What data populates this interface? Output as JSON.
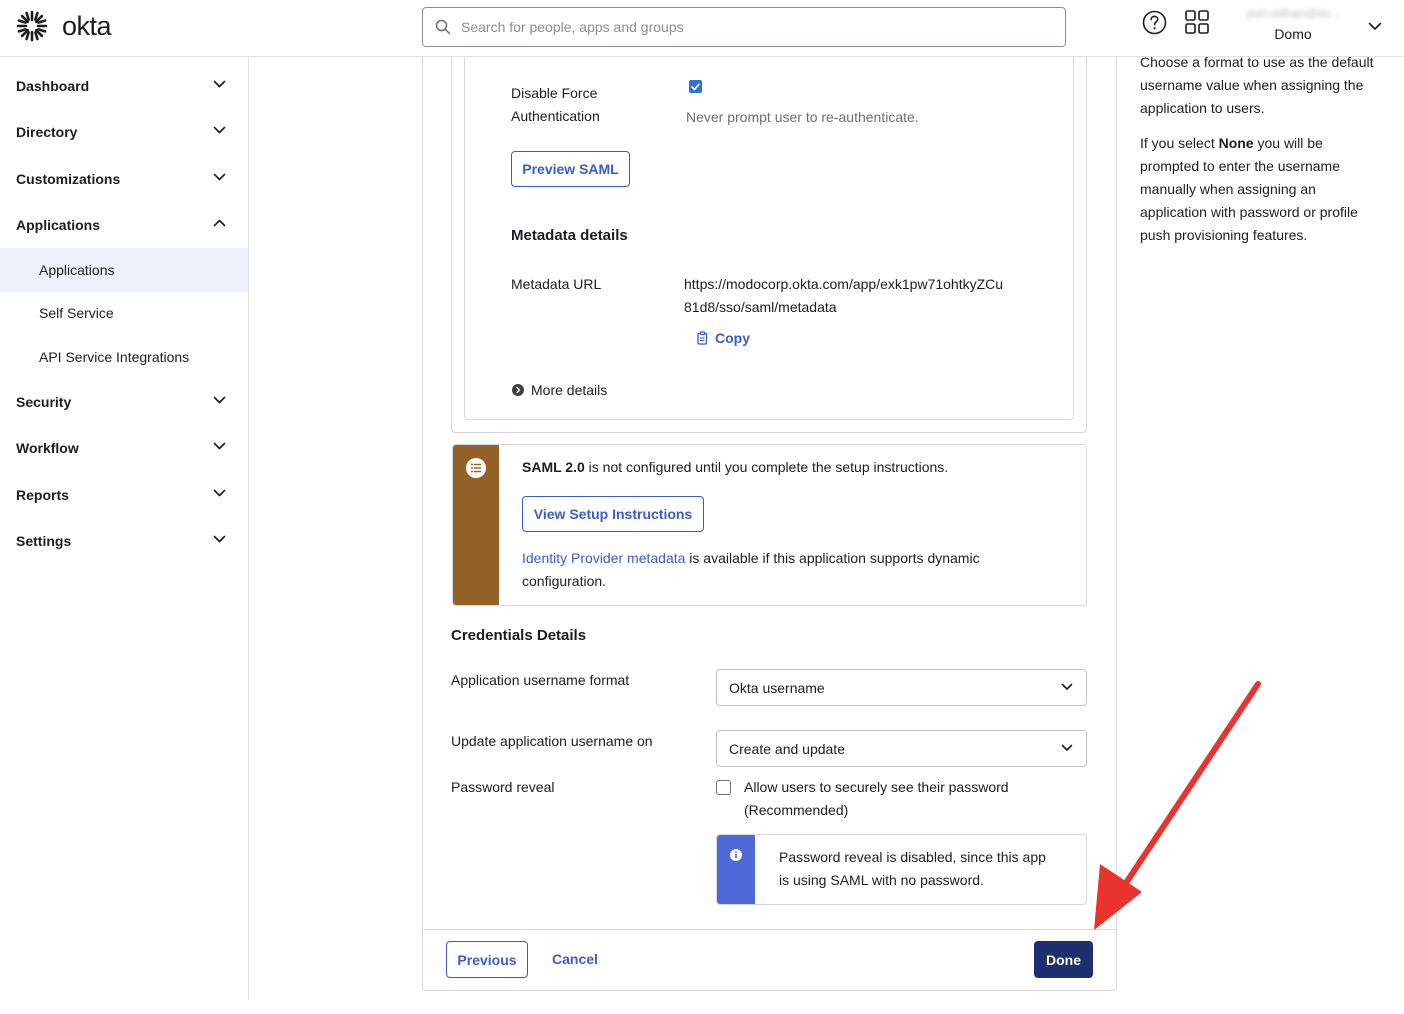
{
  "header": {
    "logo_text": "okta",
    "search_placeholder": "Search for people, apps and groups",
    "user_email": "josh.oldham@do...",
    "org_name": "Domo"
  },
  "sidebar": {
    "items": [
      {
        "label": "Dashboard"
      },
      {
        "label": "Directory"
      },
      {
        "label": "Customizations"
      },
      {
        "label": "Applications"
      },
      {
        "label": "Security"
      },
      {
        "label": "Workflow"
      },
      {
        "label": "Reports"
      },
      {
        "label": "Settings"
      }
    ],
    "applications_sub": [
      {
        "label": "Applications"
      },
      {
        "label": "Self Service"
      },
      {
        "label": "API Service Integrations"
      }
    ]
  },
  "sign_on": {
    "disable_force_label_line1": "Disable Force",
    "disable_force_label_line2": "Authentication",
    "disable_force_checked": true,
    "disable_force_help": "Never prompt user to re-authenticate.",
    "preview_saml_label": "Preview SAML",
    "metadata_title": "Metadata details",
    "metadata_url_label": "Metadata URL",
    "metadata_url_line1": "https://modocorp.okta.com/app/exk1pw71ohtkyZCu",
    "metadata_url_line2": "81d8/sso/saml/metadata",
    "copy_label": "Copy",
    "more_details_label": "More details"
  },
  "saml_callout": {
    "bold": "SAML 2.0",
    "text": " is not configured until you complete the setup instructions.",
    "button_label": "View Setup Instructions",
    "idp_link": "Identity Provider metadata",
    "idp_text_line1": " is available if this application supports dynamic",
    "idp_text_line2": "configuration."
  },
  "credentials": {
    "title": "Credentials Details",
    "username_format_label": "Application username format",
    "username_format_value": "Okta username",
    "update_on_label": "Update application username on",
    "update_on_value": "Create and update",
    "password_reveal_label": "Password reveal",
    "password_reveal_checked": false,
    "password_reveal_option_line1": "Allow users to securely see their password",
    "password_reveal_option_line2": "(Recommended)",
    "info_line1": "Password reveal is disabled, since this app",
    "info_line2": "is using SAML with no password."
  },
  "footer": {
    "previous_label": "Previous",
    "cancel_label": "Cancel",
    "done_label": "Done"
  },
  "help_panel": {
    "p1_line1": "Choose a format to use as the default",
    "p1_line2": "username value when assigning the",
    "p1_line3": "application to users.",
    "p2_pre": "If you select ",
    "p2_bold": "None",
    "p2_post": " you will be",
    "p2_line2": "prompted to enter the username",
    "p2_line3": "manually when assigning an",
    "p2_line4": "application with password or profile",
    "p2_line5": "push provisioning features."
  },
  "colors": {
    "accent": "#3a5ccc",
    "primary_button": "#1e2e6e",
    "saml_bar": "#946128",
    "info_bar": "#4f6ad6",
    "annotation_arrow": "#e8342c"
  }
}
